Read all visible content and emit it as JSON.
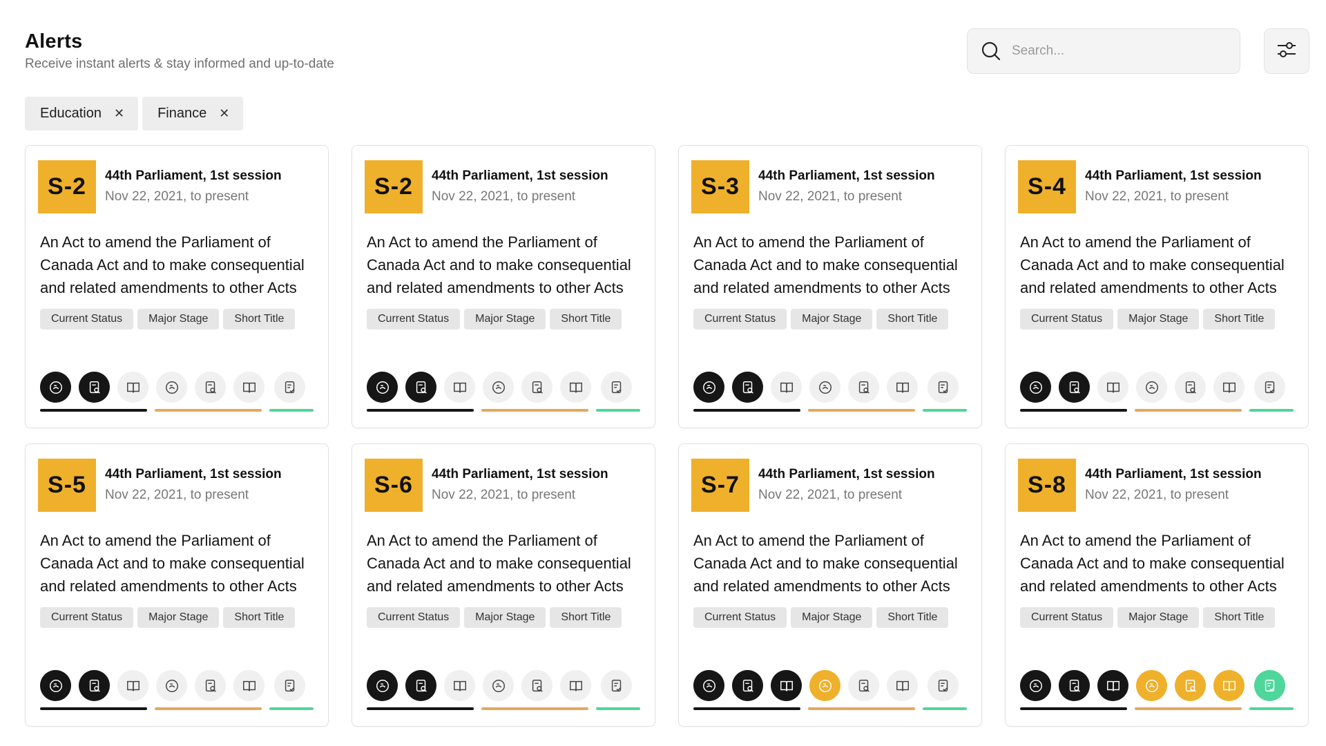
{
  "header": {
    "title": "Alerts",
    "subtitle": "Receive instant alerts & stay informed and up-to-date"
  },
  "search": {
    "placeholder": "Search..."
  },
  "filters": [
    {
      "label": "Education"
    },
    {
      "label": "Finance"
    }
  ],
  "colors": {
    "accent": "#efb02b",
    "dark": "#161616",
    "green": "#4fd69a",
    "orange": "#e3a95a"
  },
  "tag_labels": [
    "Current Status",
    "Major Stage",
    "Short Title"
  ],
  "cards": [
    {
      "bill": "S-2",
      "session": "44th Parliament, 1st session",
      "date": "Nov 22, 2021, to present",
      "description": "An Act to amend the Parliament of Canada Act and to make consequential and related amendments to other Acts",
      "stages": [
        "dark",
        "dark",
        "light",
        "light",
        "light",
        "light",
        "light"
      ]
    },
    {
      "bill": "S-2",
      "session": "44th Parliament, 1st session",
      "date": "Nov 22, 2021, to present",
      "description": "An Act to amend the Parliament of Canada Act and to make consequential and related amendments to other Acts",
      "stages": [
        "dark",
        "dark",
        "light",
        "light",
        "light",
        "light",
        "light"
      ]
    },
    {
      "bill": "S-3",
      "session": "44th Parliament, 1st session",
      "date": "Nov 22, 2021, to present",
      "description": "An Act to amend the Parliament of Canada Act and to make consequential and related amendments to other Acts",
      "stages": [
        "dark",
        "dark",
        "light",
        "light",
        "light",
        "light",
        "light"
      ]
    },
    {
      "bill": "S-4",
      "session": "44th Parliament, 1st session",
      "date": "Nov 22, 2021, to present",
      "description": "An Act to amend the Parliament of Canada Act and to make consequential and related amendments to other Acts",
      "stages": [
        "dark",
        "dark",
        "light",
        "light",
        "light",
        "light",
        "light"
      ]
    },
    {
      "bill": "S-5",
      "session": "44th Parliament, 1st session",
      "date": "Nov 22, 2021, to present",
      "description": "An Act to amend the Parliament of Canada Act and to make consequential and related amendments to other Acts",
      "stages": [
        "dark",
        "dark",
        "light",
        "light",
        "light",
        "light",
        "light"
      ]
    },
    {
      "bill": "S-6",
      "session": "44th Parliament, 1st session",
      "date": "Nov 22, 2021, to present",
      "description": "An Act to amend the Parliament of Canada Act and to make consequential and related amendments to other Acts",
      "stages": [
        "dark",
        "dark",
        "light",
        "light",
        "light",
        "light",
        "light"
      ]
    },
    {
      "bill": "S-7",
      "session": "44th Parliament, 1st session",
      "date": "Nov 22, 2021, to present",
      "description": "An Act to amend the Parliament of Canada Act and to make consequential and related amendments to other Acts",
      "stages": [
        "dark",
        "dark",
        "dark",
        "yellow",
        "light",
        "light",
        "light"
      ]
    },
    {
      "bill": "S-8",
      "session": "44th Parliament, 1st session",
      "date": "Nov 22, 2021, to present",
      "description": "An Act to amend the Parliament of Canada Act and to make consequential and related amendments to other Acts",
      "stages": [
        "dark",
        "dark",
        "dark",
        "yellow",
        "yellow",
        "yellow",
        "green"
      ]
    }
  ]
}
